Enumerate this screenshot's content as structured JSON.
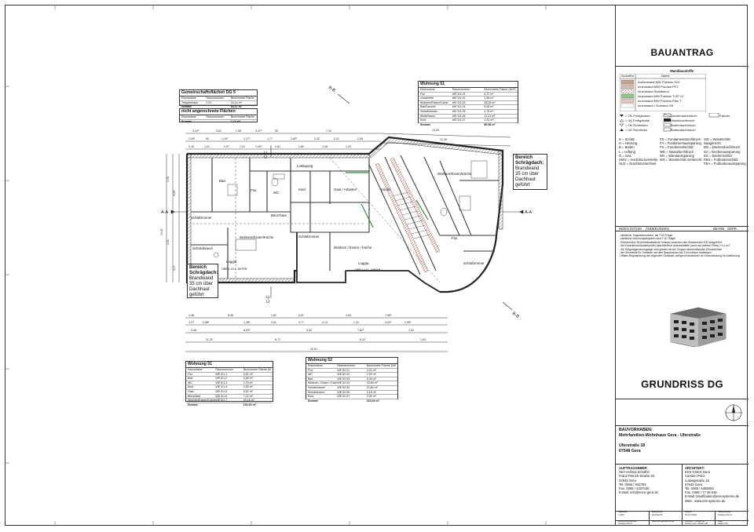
{
  "titleblock": {
    "header": "BAUANTRAG",
    "legend_title": "Wandbaustoffe",
    "legend_col1": "Schraffur",
    "legend_col2": "Name",
    "legend_items": [
      "Außenwand-MW Porotan S10",
      "Innenwand-MW Porotan PF2",
      "Innenwand Stahlbeton",
      "Innenwand MW Porotan T.GP 12",
      "Innenwand MW Porotan Plan T",
      "Innenwand / Vorwand GK"
    ],
    "symbols": [
      "= OK Fertigboden",
      "= UK Fertigdecke",
      "= OK Rohboden",
      "= UK Rohdecke"
    ],
    "symbols2": [
      "Deckendurchbruch",
      "Wanddurchbruch",
      "Bodendurchbruch",
      "Bodendurchbruch"
    ],
    "symbol_extra": "Fallrohr",
    "abbrev_col1": [
      "S = Schlitz",
      "H = Heizung",
      "B = Boden",
      "L = Lüftung",
      "G = Gas",
      "HWV = Hochdruckverteiler",
      "SUS = Durchbrüche/Insel"
    ],
    "abbrev_col2": [
      "FD = Fundamentdurchbruch",
      "FA = Fundamentaussparung",
      "FS = Fundamentschlitz",
      "WD = Wanddurchbruch",
      "WA = Wandaussparung",
      "WS = Wandschlitz senkrecht"
    ],
    "abbrev_col3": [
      "SW = Wandschlitz waagerecht",
      "DD = Deckendurchbruch",
      "DA = Deckenaussparung",
      "DS = Deckenschlitz",
      "FBS = Fußbodenschlitz",
      "FBA = Fußbodenaussparung"
    ],
    "revision_header": [
      "INDEX",
      "DATUM",
      "ÄNDERUNGEN",
      "BEARB.",
      "GEPR."
    ],
    "notes": [
      "- sämtliche Tragwerksnotizen, als T 00 Träger",
      "- sämtliche Wohnungsangaben sind T 00 Träger",
      "- Erforderliche Sicherheitsabstände müssen zwischen den Brandschutz-EIN ausgeführt.",
      "- die Kontrolleure/Aussenprüfer abschließend einzubehalten (auch auf weitere Pläne) +0,1 m2",
      "- die Tiefgaragendurchgänge sind geklärt mit der Gruppe abschnittsweise Erfordernisse",
      "- die Geometrie für Gebäude mit dem Brandschutz bis 3 km kritisch bestätigen",
      "- Mittels Begutachtung der folgenden Gebäude zwingend bestimmen ist Voraussetzung für Ausführung"
    ],
    "drawing_title": "GRUNDRISS DG",
    "project_label": "BAUVORHABEN:",
    "project_name": "Mehrfamilien-Wohnhaus Gera - Uferstraße",
    "address_line1": "Uferstraße 18",
    "address_line2": "07548 Gera",
    "client_label": "AUFTRAGGEBER:",
    "client_lines": [
      "Herr Helmut Schaffel",
      "Franz-Petrich-Straße 48",
      "07545 Gera",
      "",
      "Tel. 0365 / 833793",
      "Fax. 0365 / 4337330",
      "E-Mail: info@enco-gera.de"
    ],
    "architect_label": "ARCHITEKT:",
    "architect_lines": [
      "ESS GmbH Gera",
      "Carsten Prinz",
      "Ludwigstraße 1b",
      "07545 Gera",
      "",
      "Tel. 0365 / 5485063",
      "Fax. 0365 / 77 36 645",
      "E-Mail: bmaffinalen@ess-systeme.de",
      "Web.: www.ess-systeme.de"
    ],
    "footer_headers": [
      "Maßstab",
      "Blattgröße",
      "Datum",
      "Planersteller"
    ],
    "footer_values": [
      "1:100",
      "Architecht",
      "15.07.2016",
      "Carsten Prinz"
    ],
    "footer_headers2": [
      "Entwurfsverfasser",
      "Bauvorlageberechtigt",
      "Karsten / Lüdke Nr.",
      "Plan"
    ],
    "footer_values2": [
      "Carsten Prinz",
      "",
      "M-Nummer: 00x01-46",
      "Stand: 02"
    ]
  },
  "plan": {
    "section_labels": [
      "A-A",
      "A-A",
      "B-B",
      "B-B",
      "C-C",
      "C-C"
    ],
    "table_gemeinschaft": {
      "title": "Gemeinschaftsflächen DG 5",
      "header": [
        "Raumname",
        "Raumnummer",
        "Berechnete Fläche (NGF)"
      ],
      "rows": [
        [
          "Treppenhaus",
          "2.01",
          "15,14 m²"
        ],
        [
          "Loggia",
          "4.02",
          "16,42 m²"
        ]
      ],
      "sum": [
        "Summe",
        "",
        "44,37 m²"
      ]
    },
    "table_nicht": {
      "title": "nicht angerechnete Flächen",
      "header": [
        "Raumname",
        "Raumnummer",
        "Berechnete Fläche (NGF)"
      ],
      "rows": [
        [
          "Dachraum",
          "4.03",
          "2,74 m²"
        ]
      ],
      "sum": [
        "Summe",
        "",
        "2,74 m²"
      ]
    },
    "table_w51": {
      "title": "Wohnung 51",
      "header": [
        "Raumname",
        "Raumnummer",
        "Berechnete Fläche (NGF)"
      ],
      "rows": [
        [
          "Flur",
          "WE 5/1.01",
          "4,17 m²"
        ],
        [
          "Garderobe",
          "WE 5/1.02",
          "1,96 m²"
        ],
        [
          "Wohnen/Essen/Küche",
          "WE 5/1.03",
          "28,05 m²"
        ],
        [
          "Bad/Dusche",
          "WE 5/1.04",
          "6,08 m²"
        ],
        [
          "Schlafzimmer",
          "WE 5/1.05",
          "4,76 m²"
        ],
        [
          "Abstellraum",
          "WE 5/1.06",
          "11,31 m²"
        ],
        [
          "Kind",
          "WE 5/1.07",
          "1,91 m²"
        ],
        [
          "Gast/Arbeit",
          "WE 5/1.08",
          "3,73 m²"
        ],
        [
          "HWR",
          "WE 5/1.09",
          "3,72 m²"
        ],
        [
          "Flur 2",
          "WE 5/1.10",
          "2,56 m²"
        ],
        [
          "Loggia",
          "WE 5/1.11",
          "12,14 m²"
        ]
      ],
      "sum": [
        "Summe",
        "",
        "80,98 m²"
      ]
    },
    "table_w51b": {
      "title": "Wohnung 51",
      "header": [
        "Raumname",
        "Raumnummer",
        "Berechnete Fläche (NGF)"
      ],
      "rows": [
        [
          "Flur",
          "WE 5/1.1",
          "6,81 m²"
        ],
        [
          "Bad",
          "WE 5/1.2",
          "5,86 m²"
        ],
        [
          "WC",
          "WE 5/1.3",
          "2,75 m²"
        ],
        [
          "Kind",
          "WE 5/1.4",
          "9,35 m²"
        ],
        [
          "Gast",
          "WE 5/1.5",
          "8,52 m²"
        ],
        [
          "Büro/Gast",
          "WE 5/1.6",
          "7,42 m²"
        ],
        [
          "Wohnen/Essen/Küche",
          "WE 5/1.7",
          "43,16 m²"
        ],
        [
          "Schlafzimmer",
          "WE 5/1.8",
          "14,47 m²"
        ],
        [
          "Schrankraum",
          "WE 5/1.9",
          "6,02 m²"
        ],
        [
          "Loggia",
          "WE 5/1.10",
          "13,37 m²"
        ]
      ],
      "sum": [
        "Summe",
        "",
        "102,03 m²"
      ]
    },
    "table_w52": {
      "title": "Wohnung 52",
      "header": [
        "Raumname",
        "Raumnummer",
        "Berechnete Fläche (NGF)"
      ],
      "rows": [
        [
          "Flur",
          "WE 52.01",
          "4,93 m²"
        ],
        [
          "WC",
          "WE 52.02",
          "2,39 m²"
        ],
        [
          "Bad",
          "WE 52.03",
          "8,36 m²"
        ],
        [
          "Wohnen / Essen / Küche",
          "WE 52.04",
          "33,66 m²"
        ],
        [
          "Schlafzimmer",
          "WE 52.05",
          "13,84 m²"
        ],
        [
          "Schrankraum",
          "WE 52.06",
          "5,18 m²"
        ],
        [
          "Kind",
          "WE 52.07",
          "9,35 m²"
        ],
        [
          "Gast / Arbeiten",
          "WE 52.08",
          "8,11 m²"
        ],
        [
          "Büro",
          "WE 52.09",
          "5,78 m²"
        ],
        [
          "Loggia",
          "WE 52.10",
          "13,44 m²"
        ]
      ],
      "sum": [
        "Summe",
        "",
        "110,04 m²"
      ]
    },
    "rooms": [
      "Loslagung",
      "Flur",
      "Bad",
      "WC",
      "Kind",
      "Gast / Arbeiten",
      "Büro/Gast",
      "Schlafzimmer",
      "Wohnen/Essen/Küche",
      "Schrankraum",
      "Schlafzimmer",
      "Wohnen / Essen / Küche",
      "Küche",
      "Flur",
      "Schlafzimmer",
      "Wohnen/Essen/Küche",
      "Loggia",
      "Loggia"
    ],
    "callout_left": [
      "Bereich",
      "Schrägdach:",
      "Brandwand",
      "35 cm über",
      "Dachhaut",
      "geführt"
    ],
    "callout_right": [
      "Bereich",
      "Schrägdach:",
      "Brandwand",
      "35 cm über",
      "Dachhaut",
      "geführt"
    ],
    "hbr_left": "HBR 1,15 L. DKFFB",
    "hbr_mid": "HBR 1,11 L. DKFFB",
    "total_dim": "25,51",
    "dims_bottom": [
      "11,32",
      "8,71",
      "8,23",
      "1,62"
    ],
    "dims_top": [
      "13,53",
      "12,35"
    ]
  }
}
